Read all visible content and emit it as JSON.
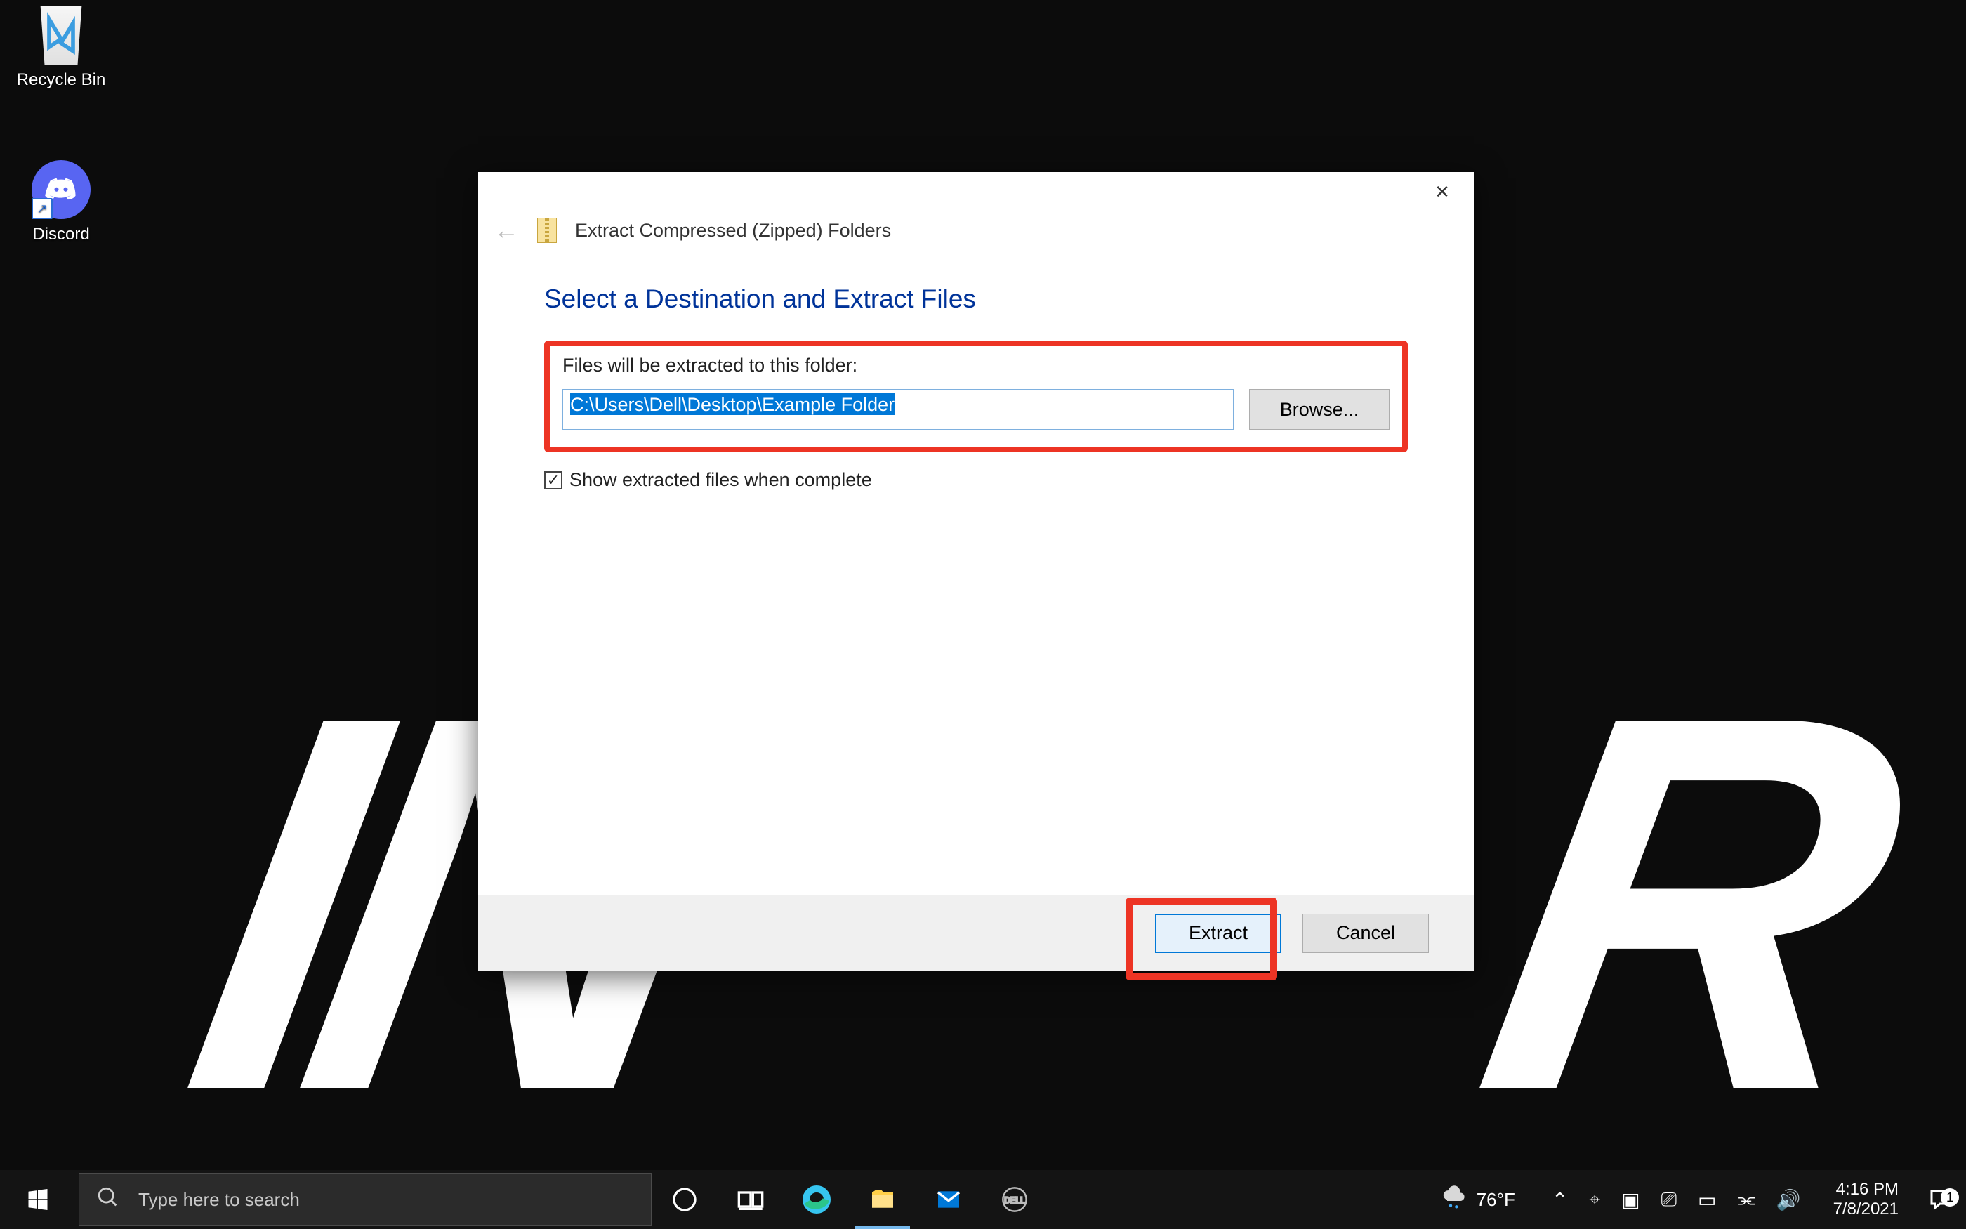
{
  "desktop": {
    "wallpaper_letters": {
      "left": "I N",
      "right": "R"
    },
    "icons": {
      "recycle": "Recycle Bin",
      "discord": "Discord"
    }
  },
  "dialog": {
    "title": "Extract Compressed (Zipped) Folders",
    "close_symbol": "✕",
    "back_symbol": "←",
    "heading": "Select a Destination and Extract Files",
    "field_label": "Files will be extracted to this folder:",
    "path_value": "C:\\Users\\Dell\\Desktop\\Example Folder",
    "browse_label": "Browse...",
    "checkbox_label": "Show extracted files when complete",
    "checkbox_checked": true,
    "footer": {
      "primary": "Extract",
      "cancel": "Cancel"
    }
  },
  "taskbar": {
    "search_placeholder": "Type here to search",
    "weather": {
      "temp": "76°F"
    },
    "clock": {
      "time": "4:16 PM",
      "date": "7/8/2021"
    },
    "notification_count": "1",
    "tray_glyphs": {
      "chevron": "⌃",
      "location": "⌖",
      "meet": "▣",
      "device": "⎚",
      "battery": "▭",
      "wifi": "⫘",
      "sound": "🔊"
    }
  },
  "colors": {
    "highlight_red": "#ed3424",
    "win_blue": "#0078d7",
    "heading_blue": "#003399",
    "discord": "#5865f2"
  }
}
